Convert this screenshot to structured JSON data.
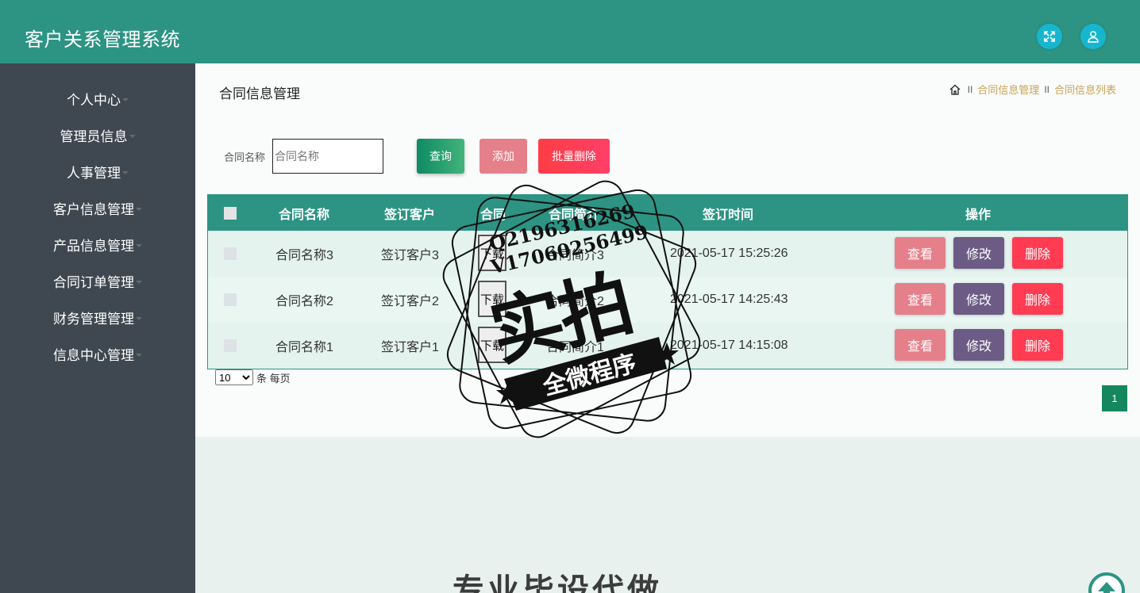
{
  "header": {
    "title": "客户关系管理系统",
    "fullscreen_icon": "fullscreen-icon",
    "user_icon": "user-icon",
    "button_color": "#17b6cf",
    "bar_color": "#2d9484"
  },
  "sidebar": {
    "items": [
      {
        "label": "个人中心"
      },
      {
        "label": "管理员信息"
      },
      {
        "label": "人事管理"
      },
      {
        "label": "客户信息管理"
      },
      {
        "label": "产品信息管理"
      },
      {
        "label": "合同订单管理"
      },
      {
        "label": "财务管理管理"
      },
      {
        "label": "信息中心管理"
      }
    ]
  },
  "page": {
    "title": "合同信息管理",
    "breadcrumb": [
      "合同信息管理",
      "合同信息列表"
    ],
    "breadcrumb_sep": "II"
  },
  "search": {
    "label": "合同名称",
    "placeholder": "合同名称",
    "value": ""
  },
  "toolbar": {
    "query_label": "查询",
    "add_label": "添加",
    "batch_delete_label": "批量删除"
  },
  "table": {
    "columns": [
      "合同名称",
      "签订客户",
      "合同",
      "合同简介",
      "签订时间",
      "操作"
    ],
    "rows": [
      {
        "name": "合同名称3",
        "customer": "签订客户3",
        "file": "下载",
        "intro": "合同简介3",
        "time": "2021-05-17 15:25:26"
      },
      {
        "name": "合同名称2",
        "customer": "签订客户2",
        "file": "下载",
        "intro": "合同简介2",
        "time": "2021-05-17 14:25:43"
      },
      {
        "name": "合同名称1",
        "customer": "签订客户1",
        "file": "下载",
        "intro": "合同简介1",
        "time": "2021-05-17 14:15:08"
      }
    ],
    "actions": {
      "view": "查看",
      "edit": "修改",
      "delete": "删除"
    }
  },
  "pagination": {
    "page_size": "10",
    "page_size_suffix": "条 每页",
    "current_page": "1"
  },
  "watermark": {
    "line1": "Q2196316269",
    "line2": "V17060256499",
    "big": "实拍",
    "banner": "全微程序",
    "bottom": "专业毕设代做"
  },
  "scroll_top_icon": "arrow-up-icon"
}
